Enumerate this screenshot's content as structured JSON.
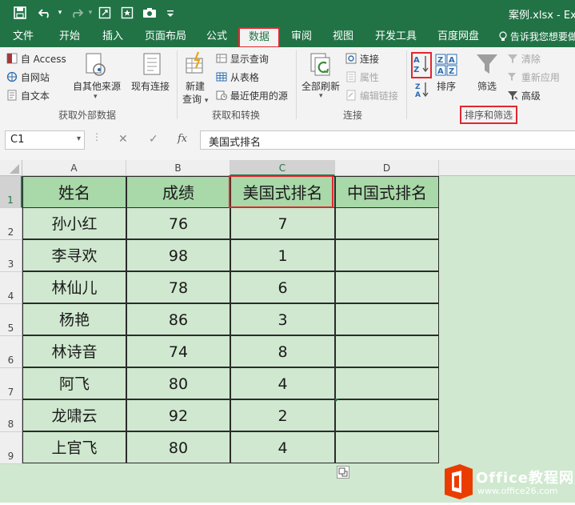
{
  "window": {
    "title": "案例.xlsx - Exce"
  },
  "tabs": [
    {
      "label": "文件"
    },
    {
      "label": "开始"
    },
    {
      "label": "插入"
    },
    {
      "label": "页面布局"
    },
    {
      "label": "公式"
    },
    {
      "label": "数据",
      "active": true
    },
    {
      "label": "审阅"
    },
    {
      "label": "视图"
    },
    {
      "label": "开发工具"
    },
    {
      "label": "百度网盘"
    }
  ],
  "tellme": "告诉我您想要做",
  "ribbon": {
    "external": {
      "access": "自 Access",
      "web": "自网站",
      "text": "自文本",
      "other": "自其他来源",
      "existing": "现有连接",
      "group": "获取外部数据"
    },
    "transform": {
      "new_query_line1": "新建",
      "new_query_line2": "查询",
      "show_queries": "显示查询",
      "from_table": "从表格",
      "recent_sources": "最近使用的源",
      "group": "获取和转换"
    },
    "connections": {
      "refresh_all": "全部刷新",
      "connections": "连接",
      "properties": "属性",
      "edit_links": "编辑链接",
      "group": "连接"
    },
    "sort_filter": {
      "sort": "排序",
      "filter": "筛选",
      "clear": "清除",
      "reapply": "重新应用",
      "advanced": "高级",
      "group": "排序和筛选"
    }
  },
  "formula_bar": {
    "name_box": "C1",
    "cancel": "✕",
    "enter": "✓",
    "fx": "fx",
    "value": "美国式排名"
  },
  "sheet": {
    "columns": [
      "A",
      "B",
      "C",
      "D"
    ],
    "rows": [
      "1",
      "2",
      "3",
      "4",
      "5",
      "6",
      "7",
      "8",
      "9"
    ],
    "headers": [
      "姓名",
      "成绩",
      "美国式排名",
      "中国式排名"
    ],
    "data": [
      [
        "孙小红",
        "76",
        "7",
        ""
      ],
      [
        "李寻欢",
        "98",
        "1",
        ""
      ],
      [
        "林仙儿",
        "78",
        "6",
        ""
      ],
      [
        "杨艳",
        "86",
        "3",
        ""
      ],
      [
        "林诗音",
        "74",
        "8",
        ""
      ],
      [
        "阿飞",
        "80",
        "4",
        ""
      ],
      [
        "龙啸云",
        "92",
        "2",
        ""
      ],
      [
        "上官飞",
        "80",
        "4",
        ""
      ]
    ],
    "selected_cell": "C1"
  },
  "watermark": {
    "brand": "Office教程网",
    "url": "www.office26.com"
  },
  "colors": {
    "excel_green": "#217346",
    "cell_green": "#cfe8cf",
    "header_green": "#a9d8a9",
    "highlight_red": "#e3262e"
  }
}
